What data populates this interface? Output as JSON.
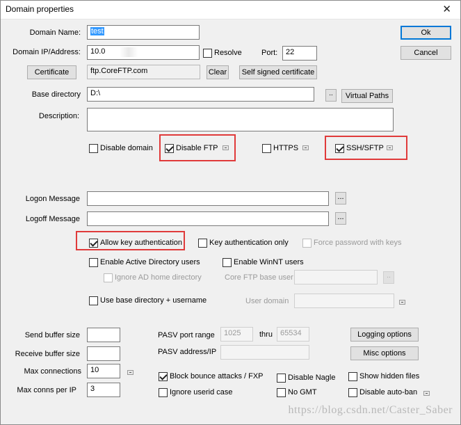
{
  "window": {
    "title": "Domain properties",
    "close_glyph": "✕"
  },
  "buttons": {
    "ok": "Ok",
    "cancel": "Cancel",
    "certificate": "Certificate",
    "clear": "Clear",
    "self_signed": "Self signed certificate",
    "browse": "..",
    "virtual_paths": "Virtual Paths",
    "ellipsis": "...",
    "logging_options": "Logging options",
    "misc_options": "Misc options"
  },
  "labels": {
    "domain_name": "Domain Name:",
    "domain_ip": "Domain IP/Address:",
    "port": "Port:",
    "base_directory": "Base directory",
    "description": "Description:",
    "logon_message": "Logon Message",
    "logoff_message": "Logoff Message",
    "core_ftp_base_user": "Core FTP base user",
    "user_domain": "User domain",
    "send_buffer_size": "Send buffer size",
    "receive_buffer_size": "Receive buffer size",
    "max_connections": "Max connections",
    "max_conns_per_ip": "Max conns per IP",
    "pasv_port_range": "PASV port range",
    "thru": "thru",
    "pasv_address_ip": "PASV address/IP"
  },
  "fields": {
    "domain_name": "test",
    "domain_ip": "10.0",
    "port": "22",
    "certificate_path": "ftp.CoreFTP.com",
    "base_directory": "D:\\",
    "description": "",
    "logon_message": "",
    "logoff_message": "",
    "core_ftp_base_user": "",
    "user_domain": "",
    "send_buffer_size": "",
    "receive_buffer_size": "",
    "max_connections": "10",
    "max_conns_per_ip": "3",
    "pasv_port_from": "1025",
    "pasv_port_thru": "65534",
    "pasv_address": ""
  },
  "checkboxes": {
    "resolve": {
      "label": "Resolve",
      "checked": false
    },
    "disable_domain": {
      "label": "Disable domain",
      "checked": false
    },
    "disable_ftp": {
      "label": "Disable FTP",
      "checked": true
    },
    "https": {
      "label": "HTTPS",
      "checked": false
    },
    "ssh_sftp": {
      "label": "SSH/SFTP",
      "checked": true
    },
    "allow_key_auth": {
      "label": "Allow key authentication",
      "checked": true
    },
    "key_auth_only": {
      "label": "Key authentication only",
      "checked": false
    },
    "force_password_keys": {
      "label": "Force password with keys",
      "checked": false
    },
    "enable_ad_users": {
      "label": "Enable Active Directory users",
      "checked": false
    },
    "enable_winnt_users": {
      "label": "Enable WinNT users",
      "checked": false
    },
    "ignore_ad_home": {
      "label": "Ignore AD home directory",
      "checked": false
    },
    "use_base_dir_username": {
      "label": "Use base directory + username",
      "checked": false
    },
    "block_bounce": {
      "label": "Block bounce attacks / FXP",
      "checked": true
    },
    "disable_nagle": {
      "label": "Disable Nagle",
      "checked": false
    },
    "show_hidden_files": {
      "label": "Show hidden files",
      "checked": false
    },
    "ignore_userid_case": {
      "label": "Ignore userid case",
      "checked": false
    },
    "no_gmt": {
      "label": "No GMT",
      "checked": false
    },
    "disable_auto_ban": {
      "label": "Disable auto-ban",
      "checked": false
    }
  },
  "watermark": "https://blog.csdn.net/Caster_Saber",
  "colors": {
    "highlight_box": "#e03a3a",
    "default_button_border": "#0078d7",
    "selection": "#3399ff"
  }
}
